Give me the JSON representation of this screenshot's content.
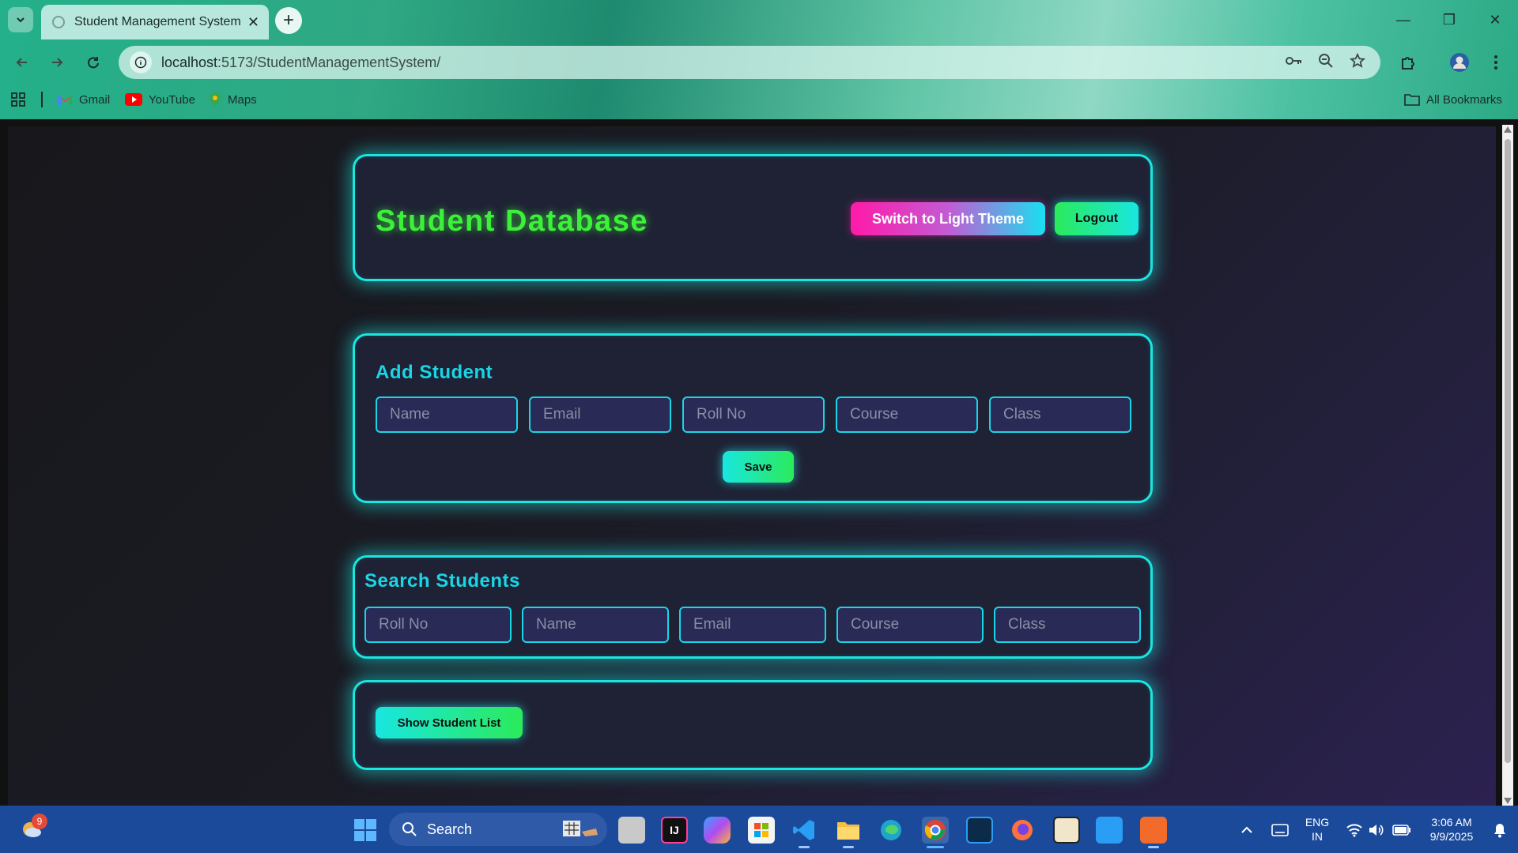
{
  "browser": {
    "tab_title": "Student Management System",
    "tab_close": "✕",
    "new_tab": "+",
    "url_host": "localhost",
    "url_path": ":5173/StudentManagementSystem/",
    "window_controls": {
      "minimize": "—",
      "restore": "❐",
      "close": "✕"
    },
    "bookmarks": [
      {
        "label": "Gmail",
        "icon": "gmail-icon"
      },
      {
        "label": "YouTube",
        "icon": "youtube-icon"
      },
      {
        "label": "Maps",
        "icon": "maps-icon"
      }
    ],
    "all_bookmarks": "All Bookmarks"
  },
  "header": {
    "title": "Student Database",
    "theme_button": "Switch to Light Theme",
    "logout_button": "Logout"
  },
  "add_student": {
    "title": "Add Student",
    "fields": [
      {
        "placeholder": "Name"
      },
      {
        "placeholder": "Email"
      },
      {
        "placeholder": "Roll No"
      },
      {
        "placeholder": "Course"
      },
      {
        "placeholder": "Class"
      }
    ],
    "save_button": "Save"
  },
  "search_students": {
    "title": "Search Students",
    "fields": [
      {
        "placeholder": "Roll No"
      },
      {
        "placeholder": "Name"
      },
      {
        "placeholder": "Email"
      },
      {
        "placeholder": "Course"
      },
      {
        "placeholder": "Class"
      }
    ]
  },
  "student_list": {
    "show_button": "Show Student List"
  },
  "taskbar": {
    "search_label": "Search",
    "notification_count": "9",
    "language": "ENG",
    "region": "IN",
    "time": "3:06 AM",
    "date": "9/9/2025"
  },
  "colors": {
    "accent_cyan": "#19e6e0",
    "title_green": "#3df03a",
    "card_bg": "#1f2235",
    "input_bg": "#292a55"
  }
}
